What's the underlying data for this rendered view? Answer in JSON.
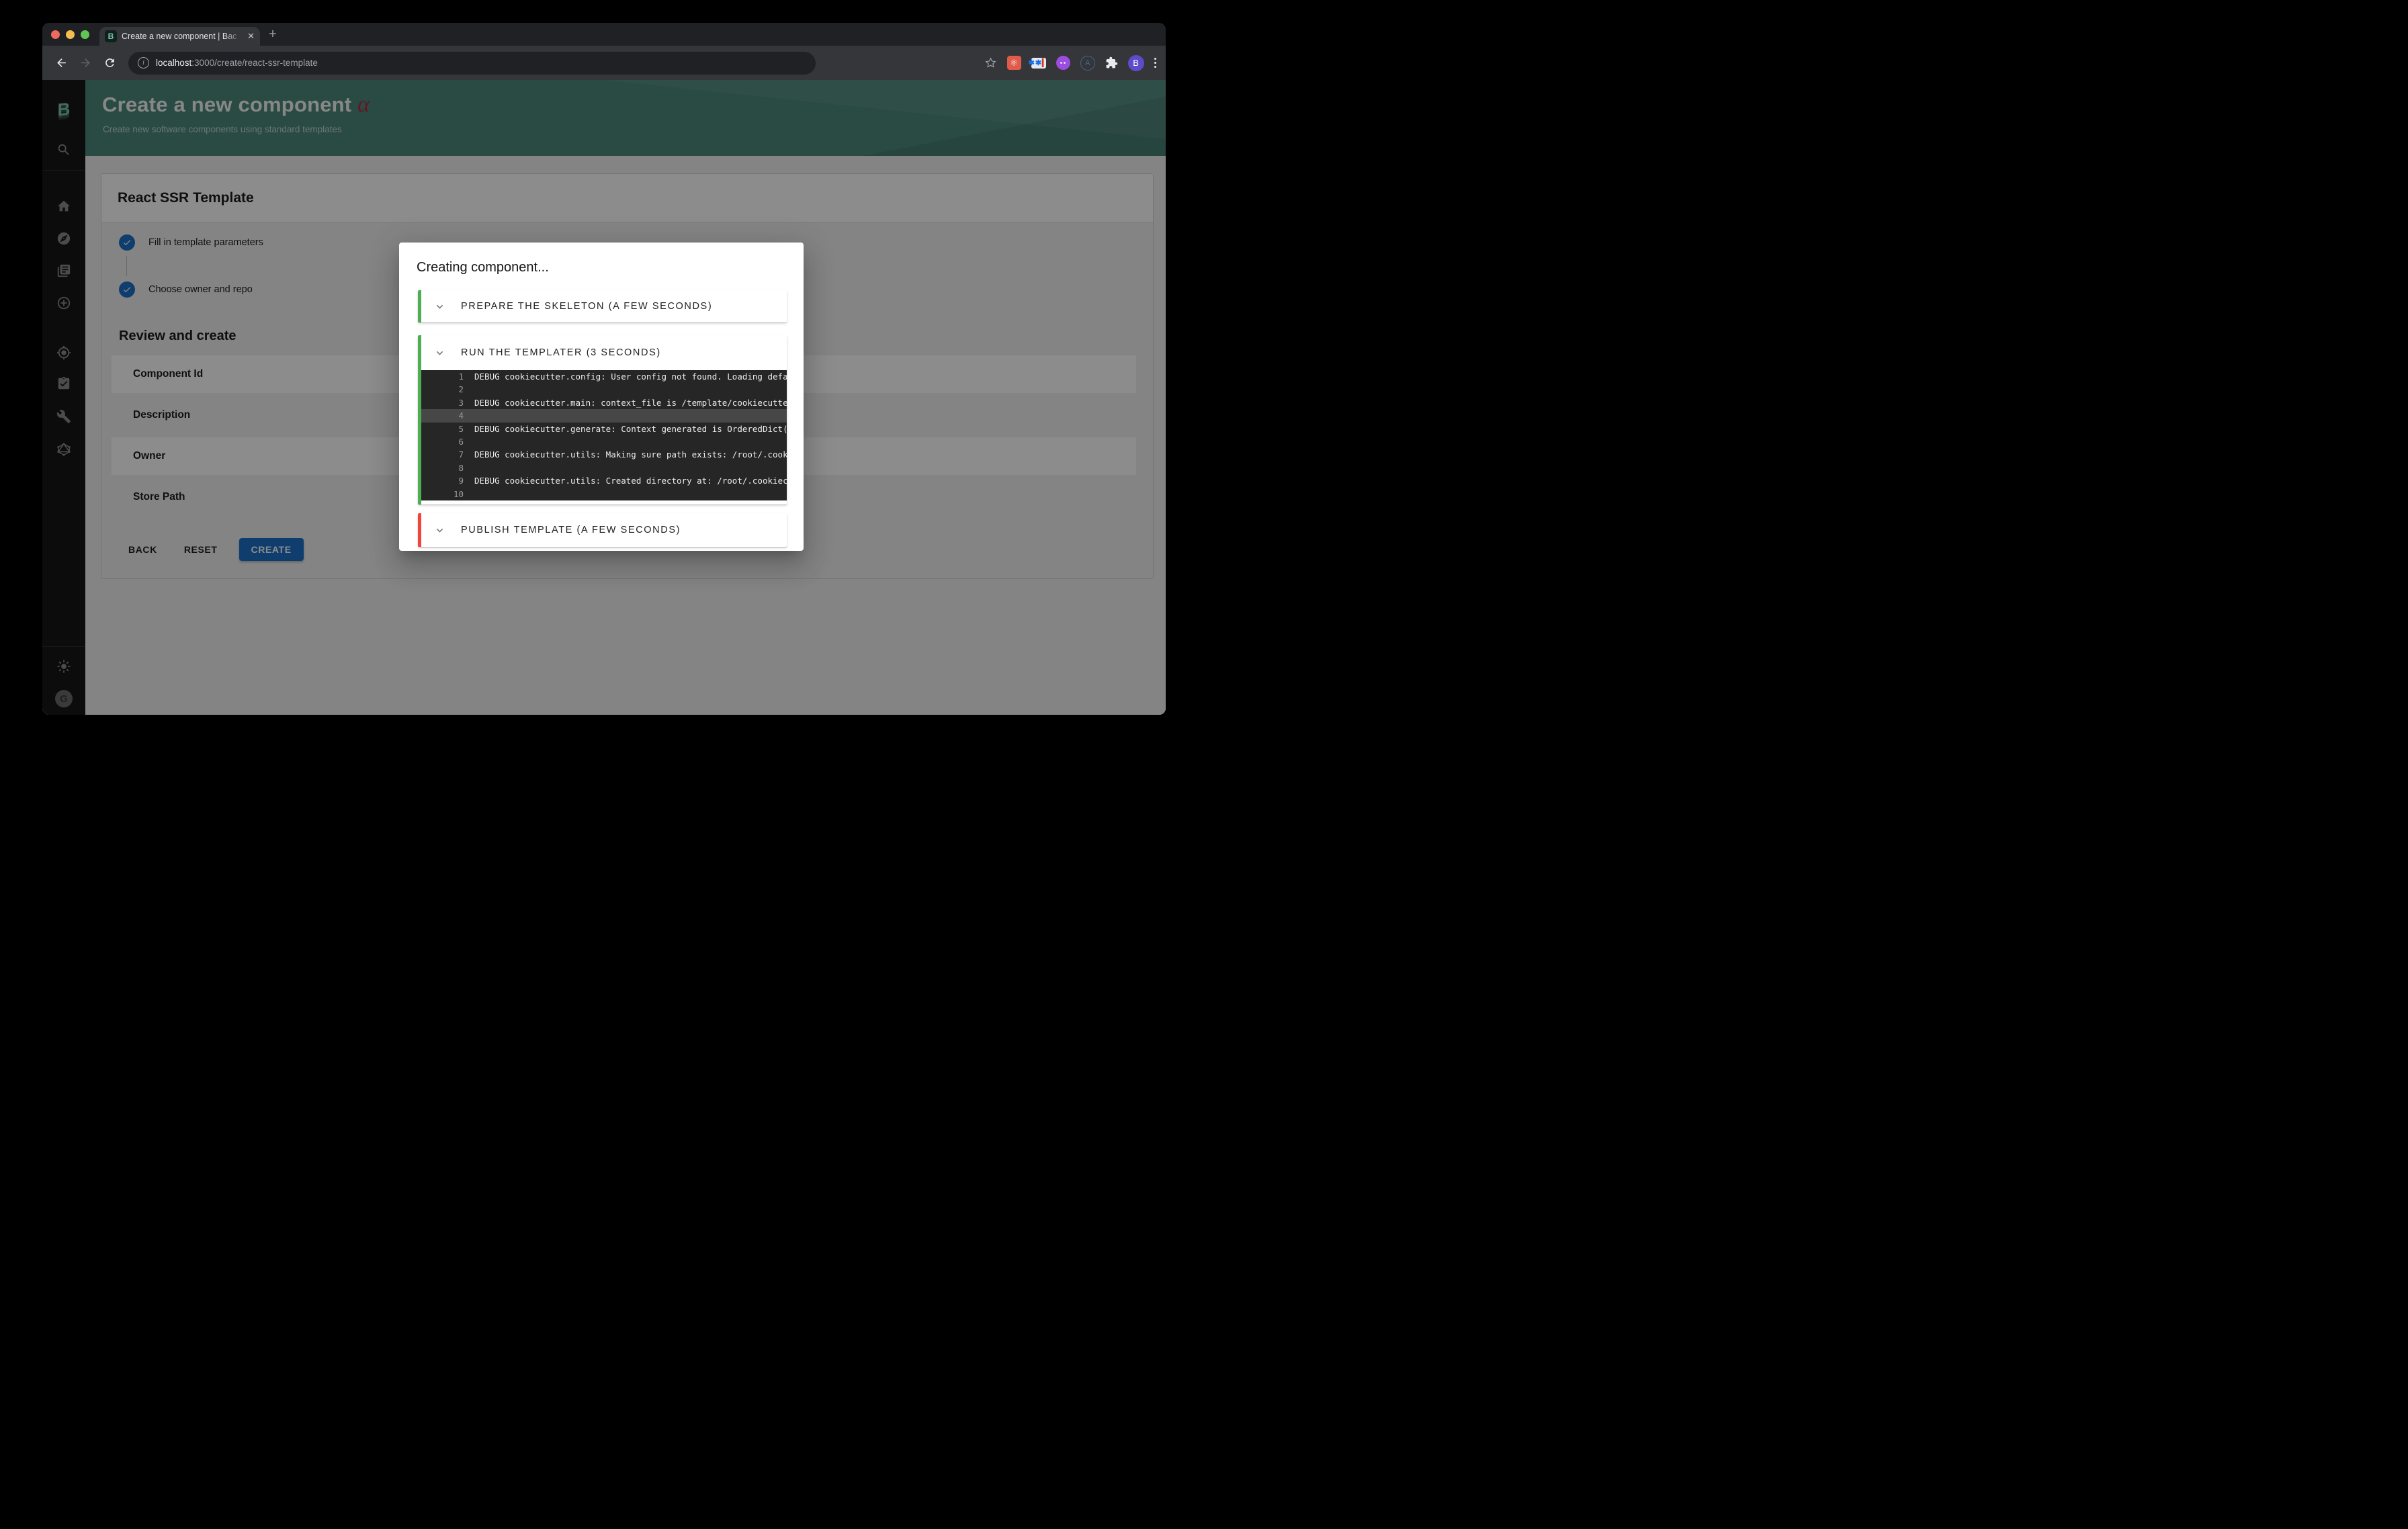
{
  "browser": {
    "tab_title": "Create a new component | Bac",
    "close_glyph": "✕",
    "newtab_glyph": "+",
    "url_host": "localhost",
    "url_path": ":3000/create/react-ssr-template",
    "a_badge": "A",
    "profile_initial": "B",
    "ext_atom_glyph": "⚛",
    "pw_glyph": "✱✱",
    "pw_bar": "▎"
  },
  "sidebar": {
    "logo_letter": "B",
    "icons": [
      "backstage-logo",
      "search",
      "home",
      "explore",
      "docs",
      "create-component",
      "locate",
      "tasks",
      "tools",
      "graphiql",
      "theme-toggle",
      "guest-avatar"
    ],
    "avatar_initial": "G"
  },
  "header": {
    "title": "Create a new component",
    "alpha_badge": "α",
    "subtitle": "Create new software components using standard templates"
  },
  "main": {
    "card_title": "React SSR Template",
    "steps": [
      {
        "label": "Fill in template parameters"
      },
      {
        "label": "Choose owner and repo"
      }
    ],
    "review": {
      "title": "Review and create",
      "rows": [
        {
          "label": "Component Id"
        },
        {
          "label": "Description"
        },
        {
          "label": "Owner"
        },
        {
          "label": "Store Path"
        }
      ]
    },
    "actions": {
      "back": "BACK",
      "reset": "RESET",
      "create": "CREATE"
    }
  },
  "modal": {
    "title": "Creating component...",
    "sections": [
      {
        "label": "PREPARE THE SKELETON (A FEW SECONDS)",
        "status_color": "#4caf50",
        "expanded": false
      },
      {
        "label": "RUN THE TEMPLATER (3 SECONDS)",
        "status_color": "#4caf50",
        "expanded": true
      },
      {
        "label": "PUBLISH TEMPLATE (A FEW SECONDS)",
        "status_color": "#f4433a",
        "expanded": false
      }
    ],
    "log_lines": [
      {
        "n": "1",
        "text": "DEBUG cookiecutter.config: User config not found. Loading default config.",
        "highlight": false
      },
      {
        "n": "2",
        "text": "",
        "highlight": false
      },
      {
        "n": "3",
        "text": "DEBUG cookiecutter.main: context_file is /template/cookiecutter.json",
        "highlight": false
      },
      {
        "n": "4",
        "text": "",
        "highlight": true
      },
      {
        "n": "5",
        "text": "DEBUG cookiecutter.generate: Context generated is OrderedDict([(u",
        "highlight": false
      },
      {
        "n": "6",
        "text": "",
        "highlight": false
      },
      {
        "n": "7",
        "text": "DEBUG cookiecutter.utils: Making sure path exists: /root/.cookiecutters",
        "highlight": false
      },
      {
        "n": "8",
        "text": "",
        "highlight": false
      },
      {
        "n": "9",
        "text": "DEBUG cookiecutter.utils: Created directory at: /root/.cookiecutters",
        "highlight": false
      },
      {
        "n": "10",
        "text": "",
        "highlight": false
      }
    ]
  },
  "colors": {
    "accent": "#1d71c9",
    "success": "#4caf50",
    "error": "#f4433a",
    "header_green": "#4c897b",
    "logo_teal": "#7cc4ae",
    "terminal_bg": "#262626",
    "terminal_highlight": "#474747"
  }
}
